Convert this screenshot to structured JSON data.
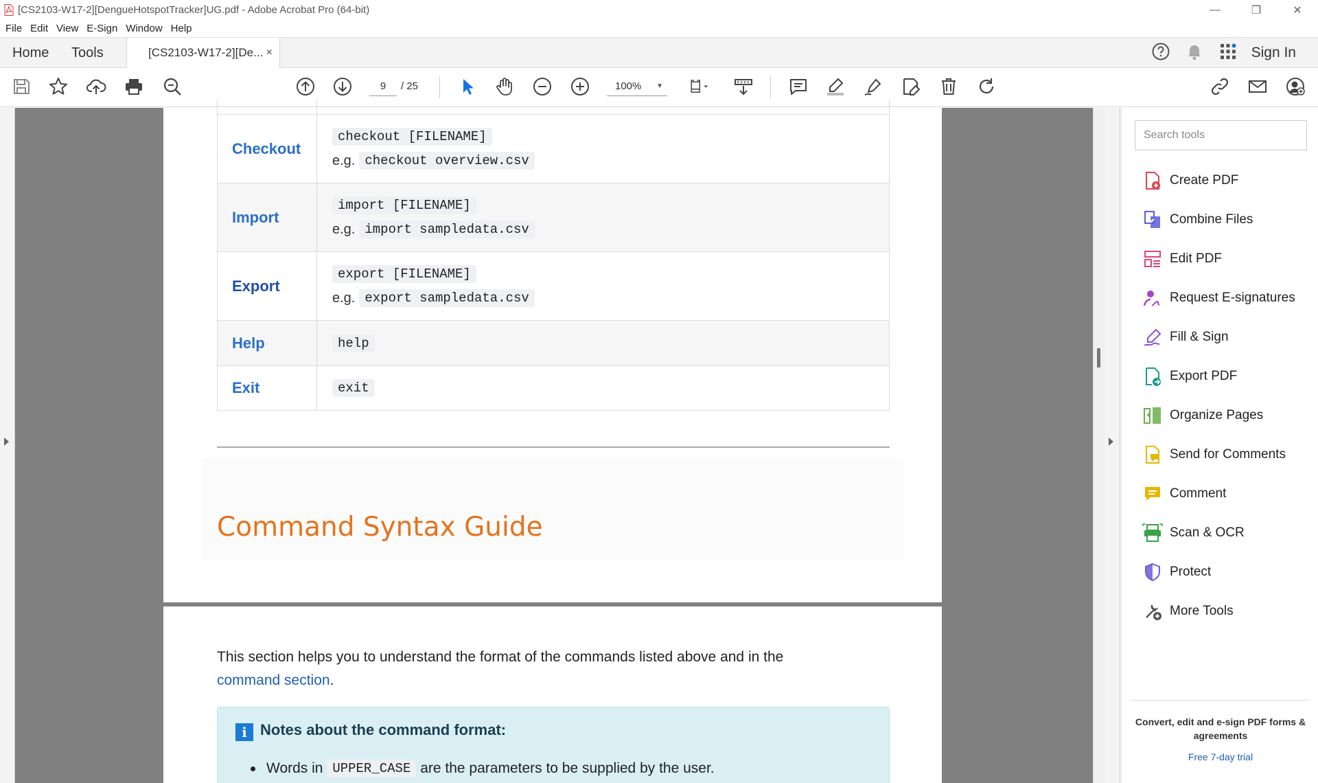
{
  "window": {
    "title": "[CS2103-W17-2][DengueHotspotTracker]UG.pdf - Adobe Acrobat Pro (64-bit)"
  },
  "menu": [
    "File",
    "Edit",
    "View",
    "E-Sign",
    "Window",
    "Help"
  ],
  "tabs": {
    "home": "Home",
    "tools": "Tools",
    "document": "[CS2103-W17-2][De...",
    "close": "×"
  },
  "header": {
    "sign_in": "Sign In"
  },
  "toolbar": {
    "page_current": "9",
    "page_total": "/ 25",
    "zoom": "100%"
  },
  "commands": [
    {
      "name": "Checkout",
      "format": "checkout [FILENAME]",
      "example_prefix": "e.g.",
      "example": "checkout overview.csv"
    },
    {
      "name": "Import",
      "format": "import [FILENAME]",
      "example_prefix": "e.g.",
      "example": "import sampledata.csv"
    },
    {
      "name": "Export",
      "format": "export [FILENAME]",
      "example_prefix": "e.g.",
      "example": "export sampledata.csv"
    },
    {
      "name": "Help",
      "format": "help"
    },
    {
      "name": "Exit",
      "format": "exit"
    }
  ],
  "section": {
    "title": "Command Syntax Guide",
    "intro": "This section helps you to understand the format of the commands listed above and in the",
    "intro_link": "command section",
    "intro_end": ".",
    "note_title": "Notes about the command format:",
    "note_bullet_prefix": "Words in",
    "note_bullet_code": "UPPER_CASE",
    "note_bullet_suffix": "are the parameters to be supplied by the user."
  },
  "right_panel": {
    "search_placeholder": "Search tools",
    "tools": [
      {
        "label": "Create PDF",
        "icon": "create-pdf-icon",
        "color": "#e0434f"
      },
      {
        "label": "Combine Files",
        "icon": "combine-files-icon",
        "color": "#5d5ddb"
      },
      {
        "label": "Edit PDF",
        "icon": "edit-pdf-icon",
        "color": "#e0437a"
      },
      {
        "label": "Request E-signatures",
        "icon": "request-esign-icon",
        "color": "#a844c8"
      },
      {
        "label": "Fill & Sign",
        "icon": "fill-sign-icon",
        "color": "#8a4fd8"
      },
      {
        "label": "Export PDF",
        "icon": "export-pdf-icon",
        "color": "#1a9c8c"
      },
      {
        "label": "Organize Pages",
        "icon": "organize-pages-icon",
        "color": "#6ab04c"
      },
      {
        "label": "Send for Comments",
        "icon": "send-comments-icon",
        "color": "#e5b800"
      },
      {
        "label": "Comment",
        "icon": "comment-icon",
        "color": "#e5b800"
      },
      {
        "label": "Scan & OCR",
        "icon": "scan-ocr-icon",
        "color": "#3aa24a"
      },
      {
        "label": "Protect",
        "icon": "protect-icon",
        "color": "#6b5dd8"
      },
      {
        "label": "More Tools",
        "icon": "more-tools-icon",
        "color": "#555555"
      }
    ],
    "promo": "Convert, edit and e-sign PDF forms & agreements",
    "trial": "Free 7-day trial"
  }
}
